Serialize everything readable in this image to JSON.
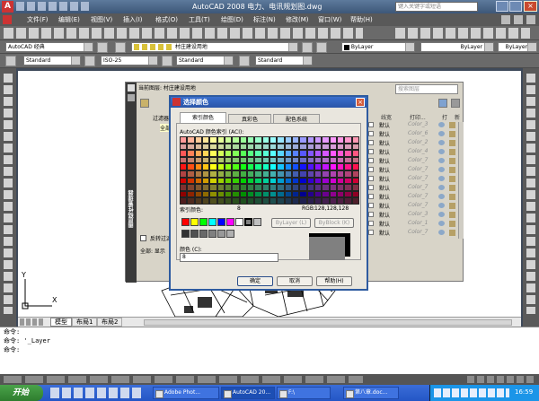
{
  "window": {
    "title": "AutoCAD 2008  电力、电讯规划图.dwg",
    "search_placeholder": "键入关键字或短语"
  },
  "menu": [
    "文件(F)",
    "编辑(E)",
    "视图(V)",
    "插入(I)",
    "格式(O)",
    "工具(T)",
    "绘图(D)",
    "标注(N)",
    "修改(M)",
    "窗口(W)",
    "帮助(H)"
  ],
  "toolbar2": {
    "workspace": "AutoCAD 经典",
    "layer_combo": "村庄建设用地",
    "color_combo": "ByLayer",
    "linetype_combo": "ByLayer",
    "lineweight_combo": "ByLayer"
  },
  "toolbar3": {
    "text_style": "Standard",
    "dim_style": "ISO-25",
    "table_style": "Standard",
    "ml_style": "Standard"
  },
  "layer_palette": {
    "current_layer_label": "当前图层: 村庄建设用地",
    "search_placeholder": "搜索图层",
    "tree_label": "过滤器",
    "tree_item": "全部",
    "invert_filter": "反转过滤器",
    "footer_text": "全部: 显示",
    "side_title": "图层特性管理器",
    "col_lineweight": "线宽",
    "col_plotstyle": "打印...",
    "col_plot": "打",
    "col_new": "新",
    "rows": [
      {
        "lw": "默认",
        "style": "Color_3"
      },
      {
        "lw": "默认",
        "style": "Color_6"
      },
      {
        "lw": "默认",
        "style": "Color_2"
      },
      {
        "lw": "默认",
        "style": "Color_4"
      },
      {
        "lw": "默认",
        "style": "Color_7"
      },
      {
        "lw": "默认",
        "style": "Color_7"
      },
      {
        "lw": "默认",
        "style": "Color_7"
      },
      {
        "lw": "默认",
        "style": "Color_7"
      },
      {
        "lw": "默认",
        "style": "Color_7"
      },
      {
        "lw": "默认",
        "style": "Color_7"
      },
      {
        "lw": "默认",
        "style": "Color_3"
      },
      {
        "lw": "默认",
        "style": "Color_1"
      },
      {
        "lw": "默认",
        "style": "Color_7"
      }
    ]
  },
  "color_dialog": {
    "title": "选择颜色",
    "tabs": [
      "索引颜色",
      "真彩色",
      "配色系统"
    ],
    "aci_label": "AutoCAD 颜色索引 (ACI):",
    "index_label": "索引颜色:",
    "index_value": "8",
    "rgb_label": "RGB:",
    "rgb_value": "128,128,128",
    "bylayer_button": "ByLayer (L)",
    "byblock_button": "ByBlock (K)",
    "color_label": "颜色 (C):",
    "color_value": "8",
    "ok_button": "确定",
    "cancel_button": "取消",
    "help_button": "帮助(H)"
  },
  "model_tabs": [
    "模型",
    "布局1",
    "布局2"
  ],
  "command_lines": [
    "命令:",
    "命令: '_Layer",
    "命令:"
  ],
  "taskbar": {
    "start": "开始",
    "items": [
      "Adobe Phot...",
      "AutoCAD 20...",
      "F:\\",
      "第八章.doc..."
    ],
    "clock": "16:59"
  }
}
